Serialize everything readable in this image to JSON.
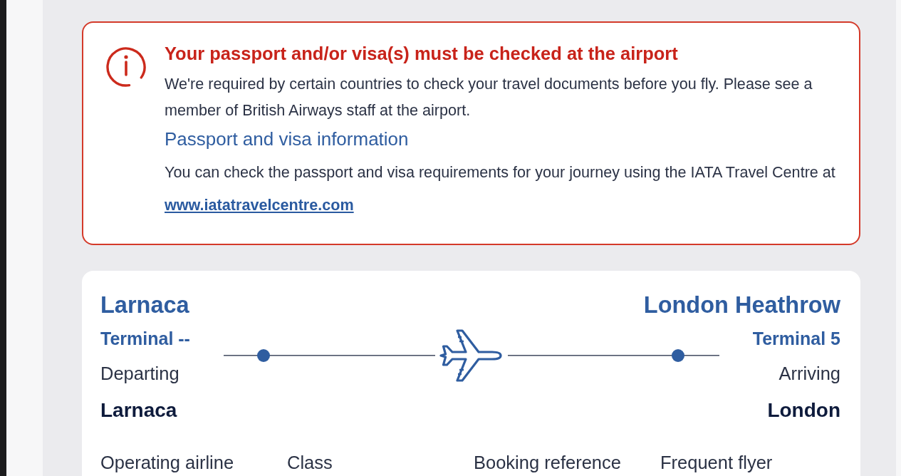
{
  "alert": {
    "title": "Your passport and/or visa(s) must be checked at the airport",
    "message": "We're required by certain countries to check your travel documents before you fly. Please see a member of British Airways staff at the airport.",
    "info_heading": "Passport and visa information",
    "info_text": "You can check the passport and visa requirements for your journey using the IATA Travel Centre at",
    "info_link": "www.iatatravelcentre.com"
  },
  "flight": {
    "departure": {
      "airport": "Larnaca",
      "terminal": "Terminal --",
      "label": "Departing",
      "city": "Larnaca"
    },
    "arrival": {
      "airport": "London Heathrow",
      "terminal": "Terminal 5",
      "label": "Arriving",
      "city": "London"
    },
    "details": {
      "columns": [
        "Operating airline",
        "Class",
        "Booking reference",
        "Frequent flyer"
      ]
    }
  }
}
